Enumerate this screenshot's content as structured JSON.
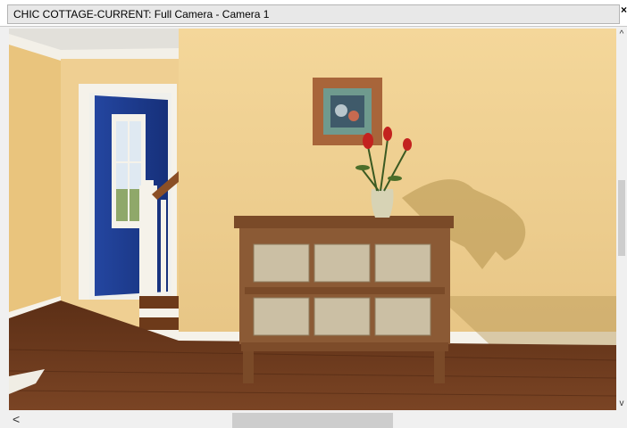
{
  "window": {
    "title": "CHIC COTTAGE-CURRENT: Full Camera - Camera 1",
    "close_glyph": "×"
  },
  "viewport": {
    "scene": "3d-camera-render",
    "colors": {
      "wall": "#f0d49a",
      "ceiling": "#e8e6e0",
      "floor": "#6b3a1e",
      "blue_wall": "#1f3a8a",
      "trim": "#f5f2ea",
      "cabinet": "#8a5a35"
    }
  },
  "scrollbars": {
    "up_glyph": "^",
    "down_glyph": "v",
    "left_glyph": "<"
  }
}
